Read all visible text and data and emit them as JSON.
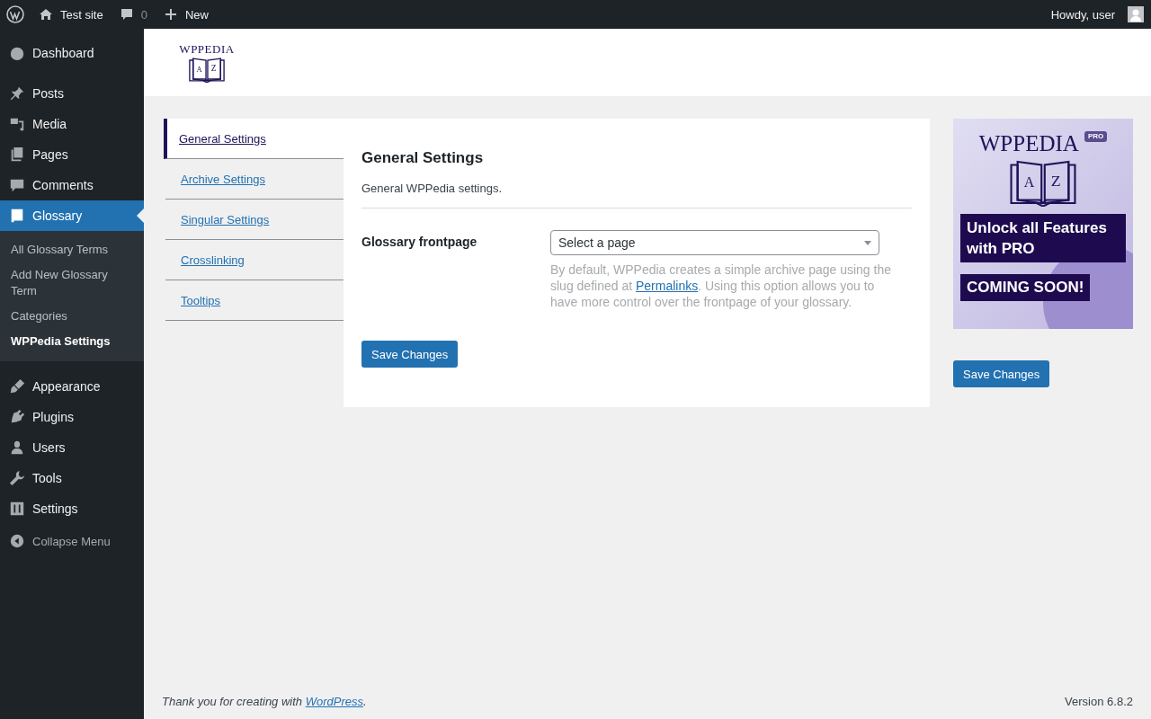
{
  "admin_bar": {
    "site": "Test site",
    "comments": "0",
    "new": "New",
    "greeting": "Howdy, user"
  },
  "sidebar": {
    "items": [
      {
        "label": "Dashboard",
        "selected": false
      },
      {
        "label": "Posts",
        "selected": false
      },
      {
        "label": "Media",
        "selected": false
      },
      {
        "label": "Pages",
        "selected": false
      },
      {
        "label": "Comments",
        "selected": false
      },
      {
        "label": "Glossary",
        "selected": true,
        "children": [
          {
            "label": "All Glossary Terms",
            "selected": false
          },
          {
            "label": "Add New Glossary Term",
            "selected": false
          },
          {
            "label": "Categories",
            "selected": false
          },
          {
            "label": "WPPedia Settings",
            "selected": true
          }
        ]
      },
      {
        "label": "Appearance",
        "selected": false
      },
      {
        "label": "Plugins",
        "selected": false
      },
      {
        "label": "Users",
        "selected": false
      },
      {
        "label": "Tools",
        "selected": false
      },
      {
        "label": "Settings",
        "selected": false
      }
    ],
    "collapse": "Collapse Menu"
  },
  "header_logo": {
    "name": "WPPEDIA",
    "left_letter": "A",
    "right_letter": "Z"
  },
  "tabs": [
    {
      "label": "General Settings",
      "selected": true
    },
    {
      "label": "Archive Settings",
      "selected": false
    },
    {
      "label": "Singular Settings",
      "selected": false
    },
    {
      "label": "Crosslinking",
      "selected": false
    },
    {
      "label": "Tooltips",
      "selected": false
    }
  ],
  "panel": {
    "title": "General Settings",
    "description": "General WPPedia settings.",
    "field_label": "Glossary frontpage",
    "select_value": "Select a page",
    "help_before": "By default, WPPedia creates a simple archive page using the slug defined at ",
    "help_link": "Permalinks",
    "help_after": ". Using this option allows you to have more control over the frontpage of your glossary.",
    "save": "Save Changes"
  },
  "promo": {
    "name": "WPPEDIA",
    "badge": "PRO",
    "left_letter": "A",
    "right_letter": "Z",
    "headline": "Unlock all Features with PRO",
    "coming": "COMING SOON!",
    "save": "Save Changes"
  },
  "footer": {
    "before": "Thank you for creating with ",
    "link": "WordPress",
    "after": ".",
    "version": "Version 6.8.2"
  }
}
